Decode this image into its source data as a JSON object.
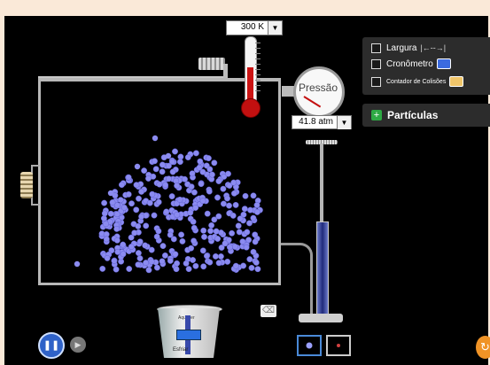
{
  "temperature": {
    "value": "300 K",
    "dropdown_icon": "caret-down-icon"
  },
  "pressure": {
    "label": "Pressão",
    "value": "41.8 atm",
    "dropdown_icon": "caret-down-icon"
  },
  "tools_panel": {
    "items": [
      {
        "label": "Largura",
        "checked": false,
        "icon": "width-arrows-icon"
      },
      {
        "label": "Cronômetro",
        "checked": false,
        "icon": "stopwatch-icon"
      },
      {
        "label": "Contador de Colisões",
        "checked": false,
        "icon": "collision-counter-icon"
      }
    ]
  },
  "particles_panel": {
    "label": "Partículas",
    "expand_icon": "plus-icon"
  },
  "heater": {
    "top_label": "Aquecer",
    "bottom_label": "Esfriar"
  },
  "playback": {
    "state": "playing",
    "play_pause_icon": "pause-icon",
    "step_icon": "step-forward-icon"
  },
  "colors": {
    "background": "#000000",
    "molecule": "#8b8bf0",
    "accent": "#2f62c8",
    "reset": "#f09326"
  }
}
